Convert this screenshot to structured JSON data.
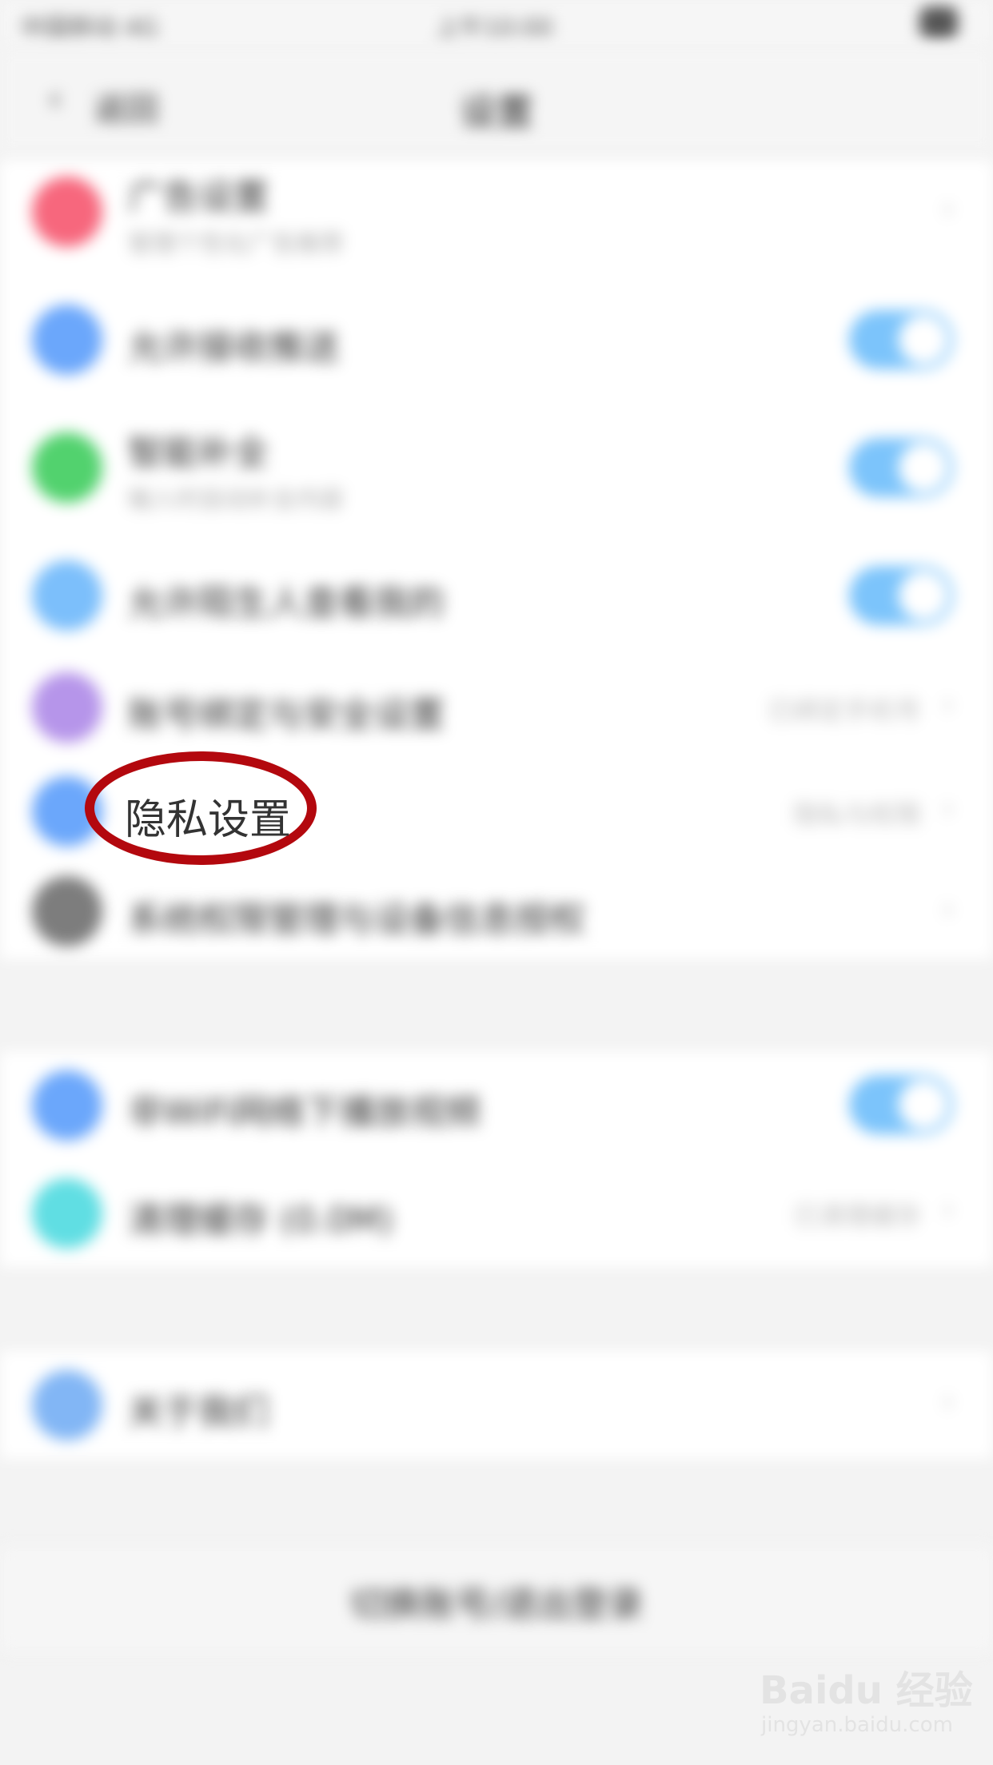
{
  "status_bar": {
    "carrier": "中国移动 4G",
    "time": "上午10:00"
  },
  "nav": {
    "back_label": "返回",
    "title": "设置"
  },
  "group1": [
    {
      "label": "广告设置",
      "sub": "管理个性化广告推荐",
      "color": "#f7677d",
      "control": "chevron"
    },
    {
      "label": "允许接收推送",
      "color": "#6ba7fb",
      "control": "toggle"
    },
    {
      "label": "智能补全",
      "sub": "输入时自动补全内容",
      "color": "#52d26e",
      "control": "toggle"
    },
    {
      "label": "允许陌生人查看我的",
      "color": "#7cbffb",
      "control": "toggle"
    },
    {
      "label": "账号绑定与安全设置",
      "value": "已绑定手机号",
      "color": "#b695ea",
      "control": "chevron"
    },
    {
      "label": "隐私设置",
      "value": "隐私与权限",
      "color": "#6ba7fb",
      "control": "chevron"
    },
    {
      "label": "系统权限管理与设备信息授权",
      "color": "#7d7d7d",
      "control": "chevron"
    }
  ],
  "group2": [
    {
      "label": "非WiFi网络下播放视频",
      "color": "#6ba7fb",
      "control": "toggle"
    },
    {
      "label": "清理缓存 (0.0M)",
      "value": "已清理缓存",
      "color": "#60dee3",
      "control": "chevron"
    }
  ],
  "group3": [
    {
      "label": "关于我们",
      "color": "#82b6f5",
      "control": "chevron"
    }
  ],
  "bottom_button": "切换账号/退出登录",
  "highlight_label": "隐私设置",
  "watermark": {
    "brand": "Baidu 经验",
    "url": "jingyan.baidu.com"
  }
}
